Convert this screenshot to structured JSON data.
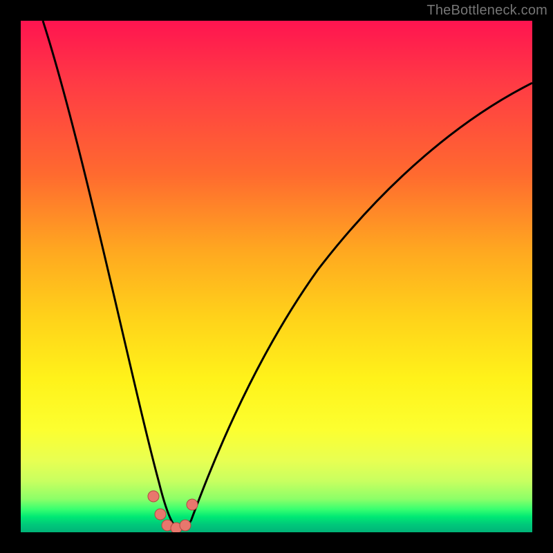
{
  "watermark": {
    "text": "TheBottleneck.com"
  },
  "colors": {
    "background": "#000000",
    "gradient_top": "#ff1450",
    "gradient_mid1": "#ffa820",
    "gradient_mid2": "#fff21a",
    "gradient_bottom": "#00b478",
    "curve_stroke": "#000000",
    "marker_fill": "#e8776d",
    "marker_stroke": "#b04a42",
    "watermark_color": "#767676"
  },
  "chart_data": {
    "type": "line",
    "title": "",
    "xlabel": "",
    "ylabel": "",
    "xlim": [
      0,
      100
    ],
    "ylim": [
      0,
      100
    ],
    "grid": false,
    "legend": false,
    "series": [
      {
        "name": "bottleneck-curve",
        "x": [
          4,
          6,
          8,
          10,
          12,
          14,
          16,
          18,
          20,
          22,
          24,
          26,
          27,
          28,
          29,
          30,
          31,
          32,
          34,
          38,
          44,
          52,
          60,
          70,
          80,
          90,
          100
        ],
        "values": [
          100,
          92,
          84,
          76,
          68,
          60,
          52,
          44,
          36,
          28,
          20,
          12,
          8,
          4,
          2,
          1,
          2,
          4,
          10,
          22,
          38,
          52,
          62,
          72,
          80,
          86,
          90
        ]
      }
    ],
    "annotations": {
      "markers": [
        {
          "x": 26.5,
          "y": 7
        },
        {
          "x": 27.5,
          "y": 3
        },
        {
          "x": 29.0,
          "y": 1
        },
        {
          "x": 30.5,
          "y": 1
        },
        {
          "x": 32.0,
          "y": 3
        },
        {
          "x": 33.0,
          "y": 6
        }
      ]
    },
    "description": "V-shaped bottleneck curve over a vertical red-to-green gradient; minimum near x≈30, y≈0. No axis ticks or labels are visible."
  }
}
